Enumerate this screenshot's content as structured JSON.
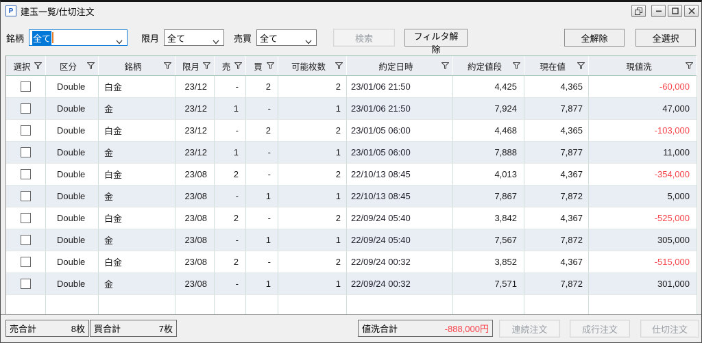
{
  "window": {
    "title": "建玉一覧/仕切注文",
    "icon_letter": "P"
  },
  "colors": {
    "accent_blue": "#0078d7",
    "negative_red": "#f8434a",
    "header_bg": "#eaedf1",
    "row_alt_bg": "#e9edf4"
  },
  "icons": {
    "filter": "funnel",
    "combo": "chevron-down",
    "window_buttons": [
      "duplicate",
      "minimize",
      "maximize",
      "close"
    ]
  },
  "toolbar": {
    "symbol_label": "銘柄",
    "symbol_value": "全て",
    "month_label": "限月",
    "month_value": "全て",
    "side_label": "売買",
    "side_value": "全て",
    "search_button": "検索",
    "filter_clear_button": "フィルタ解除",
    "deselect_all_button": "全解除",
    "select_all_button": "全選択"
  },
  "table": {
    "columns": [
      {
        "key": "select",
        "label": "選択"
      },
      {
        "key": "kubun",
        "label": "区分"
      },
      {
        "key": "meigara",
        "label": "銘柄"
      },
      {
        "key": "gengetsu",
        "label": "限月"
      },
      {
        "key": "sell",
        "label": "売"
      },
      {
        "key": "buy",
        "label": "買"
      },
      {
        "key": "qty",
        "label": "可能枚数"
      },
      {
        "key": "datetime",
        "label": "約定日時"
      },
      {
        "key": "price",
        "label": "約定値段"
      },
      {
        "key": "current",
        "label": "現在値"
      },
      {
        "key": "pl",
        "label": "現値洗"
      }
    ],
    "rows": [
      {
        "kubun": "Double",
        "meigara": "白金",
        "gengetsu": "23/12",
        "sell": "-",
        "buy": "2",
        "qty": "2",
        "datetime": "23/01/06 21:50",
        "price": "4,425",
        "current": "4,365",
        "pl": "-60,000"
      },
      {
        "kubun": "Double",
        "meigara": "金",
        "gengetsu": "23/12",
        "sell": "1",
        "buy": "-",
        "qty": "1",
        "datetime": "23/01/06 21:50",
        "price": "7,924",
        "current": "7,877",
        "pl": "47,000"
      },
      {
        "kubun": "Double",
        "meigara": "白金",
        "gengetsu": "23/12",
        "sell": "-",
        "buy": "2",
        "qty": "2",
        "datetime": "23/01/05 06:00",
        "price": "4,468",
        "current": "4,365",
        "pl": "-103,000"
      },
      {
        "kubun": "Double",
        "meigara": "金",
        "gengetsu": "23/12",
        "sell": "1",
        "buy": "-",
        "qty": "1",
        "datetime": "23/01/05 06:00",
        "price": "7,888",
        "current": "7,877",
        "pl": "11,000"
      },
      {
        "kubun": "Double",
        "meigara": "白金",
        "gengetsu": "23/08",
        "sell": "2",
        "buy": "-",
        "qty": "2",
        "datetime": "22/10/13 08:45",
        "price": "4,013",
        "current": "4,367",
        "pl": "-354,000"
      },
      {
        "kubun": "Double",
        "meigara": "金",
        "gengetsu": "23/08",
        "sell": "-",
        "buy": "1",
        "qty": "1",
        "datetime": "22/10/13 08:45",
        "price": "7,867",
        "current": "7,872",
        "pl": "5,000"
      },
      {
        "kubun": "Double",
        "meigara": "白金",
        "gengetsu": "23/08",
        "sell": "2",
        "buy": "-",
        "qty": "2",
        "datetime": "22/09/24 05:40",
        "price": "3,842",
        "current": "4,367",
        "pl": "-525,000"
      },
      {
        "kubun": "Double",
        "meigara": "金",
        "gengetsu": "23/08",
        "sell": "-",
        "buy": "1",
        "qty": "1",
        "datetime": "22/09/24 05:40",
        "price": "7,567",
        "current": "7,872",
        "pl": "305,000"
      },
      {
        "kubun": "Double",
        "meigara": "白金",
        "gengetsu": "23/08",
        "sell": "2",
        "buy": "-",
        "qty": "2",
        "datetime": "22/09/24 00:32",
        "price": "3,852",
        "current": "4,367",
        "pl": "-515,000"
      },
      {
        "kubun": "Double",
        "meigara": "金",
        "gengetsu": "23/08",
        "sell": "-",
        "buy": "1",
        "qty": "1",
        "datetime": "22/09/24 00:32",
        "price": "7,571",
        "current": "7,872",
        "pl": "301,000"
      }
    ]
  },
  "footer": {
    "sell_total_label": "売合計",
    "sell_total_value": "8枚",
    "buy_total_label": "買合計",
    "buy_total_value": "7枚",
    "pl_total_label": "値洗合計",
    "pl_total_value": "-888,000円",
    "continuous_order_button": "連続注文",
    "market_order_button": "成行注文",
    "close_order_button": "仕切注文"
  }
}
